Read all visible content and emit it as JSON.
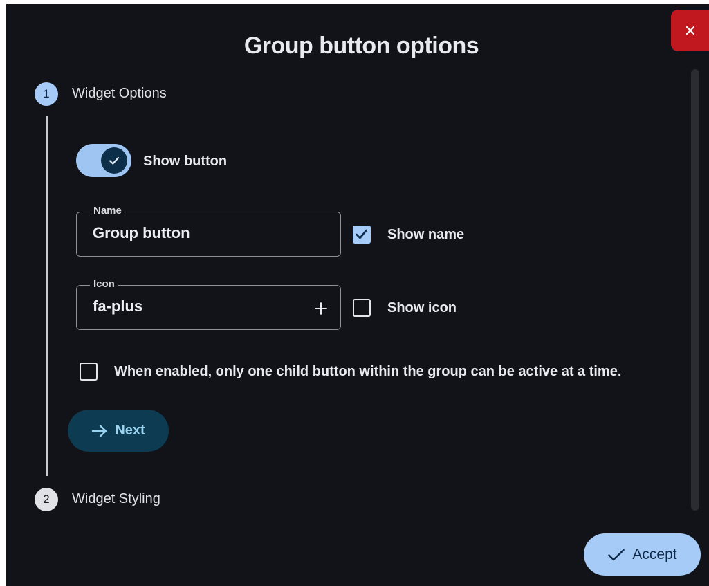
{
  "dialog": {
    "title": "Group button options",
    "close_icon": "close-icon"
  },
  "steps": [
    {
      "number": "1",
      "label": "Widget Options",
      "active": true
    },
    {
      "number": "2",
      "label": "Widget Styling",
      "active": false
    }
  ],
  "options": {
    "show_button": {
      "label": "Show button",
      "enabled": true
    },
    "name_field": {
      "legend": "Name",
      "value": "Group button"
    },
    "show_name": {
      "label": "Show name",
      "checked": true
    },
    "icon_field": {
      "legend": "Icon",
      "value": "fa-plus",
      "action_icon": "plus-icon"
    },
    "show_icon": {
      "label": "Show icon",
      "checked": false
    },
    "exclusive": {
      "label": "When enabled, only one child button within the group can be active at a time.",
      "checked": false
    }
  },
  "buttons": {
    "next_label": "Next",
    "accept_label": "Accept"
  },
  "colors": {
    "background": "#111318",
    "accent": "#a6cbf6",
    "close": "#c0181e",
    "next_button": "#0d3c52"
  }
}
